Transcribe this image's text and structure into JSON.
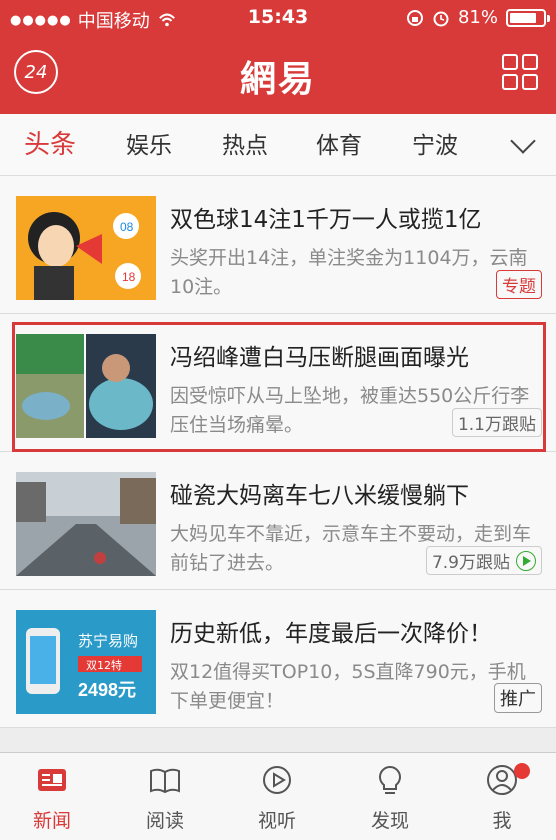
{
  "status_bar": {
    "signal": "●●●●●",
    "carrier": "中国移动",
    "time": "15:43",
    "battery": "81%",
    "battery_level": 0.81
  },
  "header": {
    "badge": "24",
    "logo": "網易"
  },
  "tabs": [
    {
      "label": "头条",
      "active": true
    },
    {
      "label": "娱乐"
    },
    {
      "label": "热点"
    },
    {
      "label": "体育"
    },
    {
      "label": "宁波"
    }
  ],
  "news": [
    {
      "title": "双色球14注1千万一人或揽1亿",
      "desc": "头奖开出14注，单注奖金为1104万，云南10注。",
      "tag": "专题"
    },
    {
      "title": "冯绍峰遭白马压断腿画面曝光",
      "desc": "因受惊吓从马上坠地，被重达550公斤行李压住当场痛晕。",
      "tag": "1.1万跟贴"
    },
    {
      "title": "碰瓷大妈离车七八米缓慢躺下",
      "desc": "大妈见车不靠近，示意车主不要动，走到车前钻了进去。",
      "tag": "7.9万跟贴"
    },
    {
      "title": "历史新低，年度最后一次降价！",
      "desc": "双12值得买TOP10，5S直降790元，手机下单更便宜！",
      "tag": "推广",
      "ad": {
        "brand": "苏宁易购",
        "sub": "双12特",
        "price": "2498元"
      }
    }
  ],
  "bottom_tabs": [
    {
      "label": "新闻",
      "active": true
    },
    {
      "label": "阅读"
    },
    {
      "label": "视听"
    },
    {
      "label": "发现"
    },
    {
      "label": "我"
    }
  ],
  "colors": {
    "accent": "#d83a3a"
  }
}
